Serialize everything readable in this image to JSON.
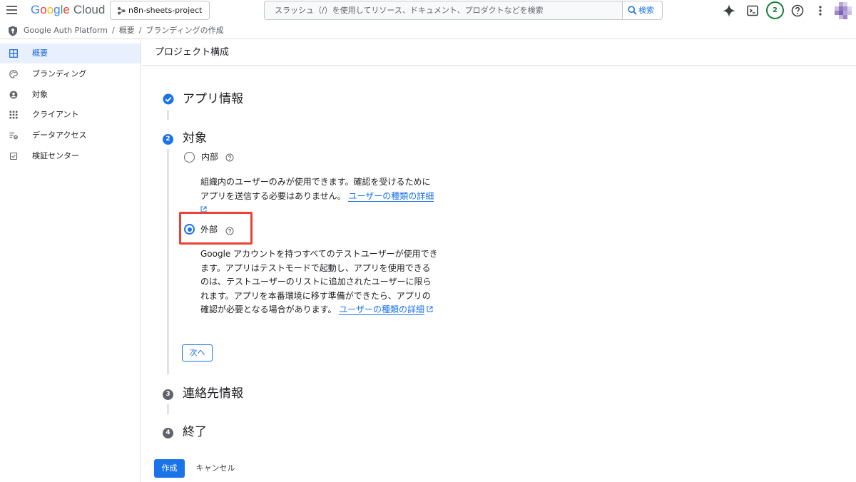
{
  "topbar": {
    "brand_letters": [
      "G",
      "o",
      "o",
      "g",
      "l",
      "e"
    ],
    "brand_suffix": "Cloud",
    "project_name": "n8n-sheets-project",
    "search_placeholder": "スラッシュ（/）を使用してリソース、ドキュメント、プロダクトなどを検索",
    "search_button_label": "検索",
    "notification_count": "2"
  },
  "breadcrumb": {
    "items": [
      "Google Auth Platform",
      "概要",
      "ブランディングの作成"
    ],
    "separator": "/"
  },
  "sidebar": {
    "items": [
      {
        "label": "概要",
        "icon": "dashboard-icon",
        "active": true
      },
      {
        "label": "ブランディング",
        "icon": "palette-icon",
        "active": false
      },
      {
        "label": "対象",
        "icon": "person-icon",
        "active": false
      },
      {
        "label": "クライアント",
        "icon": "apps-grid-icon",
        "active": false
      },
      {
        "label": "データアクセス",
        "icon": "data-settings-icon",
        "active": false
      },
      {
        "label": "検証センター",
        "icon": "checkbox-icon",
        "active": false
      }
    ]
  },
  "main": {
    "page_title": "プロジェクト構成",
    "steps": [
      {
        "number": "1",
        "title": "アプリ情報",
        "state": "completed"
      },
      {
        "number": "2",
        "title": "対象",
        "state": "active"
      },
      {
        "number": "3",
        "title": "連絡先情報",
        "state": "pending"
      },
      {
        "number": "4",
        "title": "終了",
        "state": "pending"
      }
    ],
    "audience": {
      "internal": {
        "label": "内部",
        "selected": false,
        "description_lines": [
          "組織内のユーザーのみが使用できます。確認を受けるために",
          "アプリを送信する必要はありません。"
        ],
        "link_text": "ユーザーの種類の詳細"
      },
      "external": {
        "label": "外部",
        "selected": true,
        "description_lines": [
          "Google アカウントを持つすべてのテストユーザーが使用でき",
          "ます。アプリはテストモードで起動し、アプリを使用できる",
          "のは、テストユーザーのリストに追加されたユーザーに限ら",
          "れます。アプリを本番環境に移す準備ができたら、アプリの",
          "確認が必要となる場合があります。"
        ],
        "link_text": "ユーザーの種類の詳細"
      }
    },
    "next_button": "次へ",
    "create_button": "作成",
    "cancel_button": "キャンセル"
  },
  "colors": {
    "accent": "#1a73e8",
    "highlight": "#ea4335",
    "active_nav_bg": "#e8f0fe",
    "step_pending": "#5f6368"
  }
}
